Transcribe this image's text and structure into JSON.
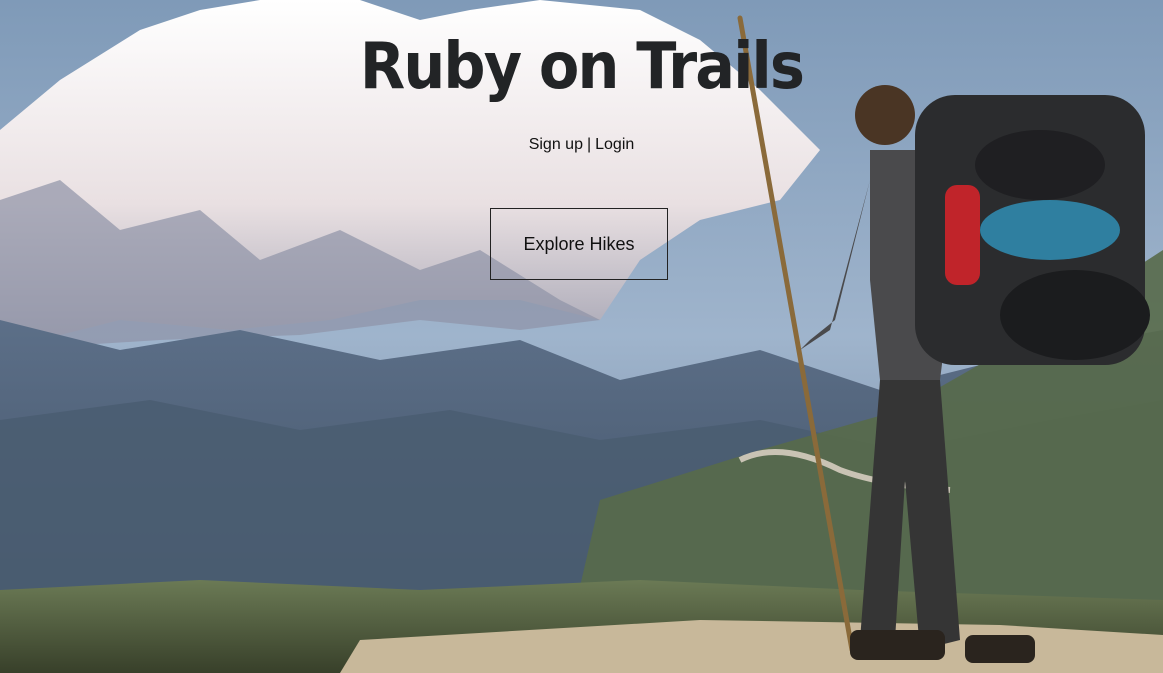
{
  "page": {
    "title": "Ruby on Trails",
    "background_image": "hiker-mountain-landscape"
  },
  "auth_links": {
    "signup_label": "Sign up",
    "separator": "|",
    "login_label": "Login"
  },
  "cta": {
    "explore_label": "Explore Hikes"
  },
  "colors": {
    "title": "#222426",
    "text": "#111111",
    "sky": "#8fa9c4",
    "snow": "#f3eeee",
    "hills": "#4d6178",
    "grass": "#5a6a3c",
    "button_border": "#222222"
  }
}
